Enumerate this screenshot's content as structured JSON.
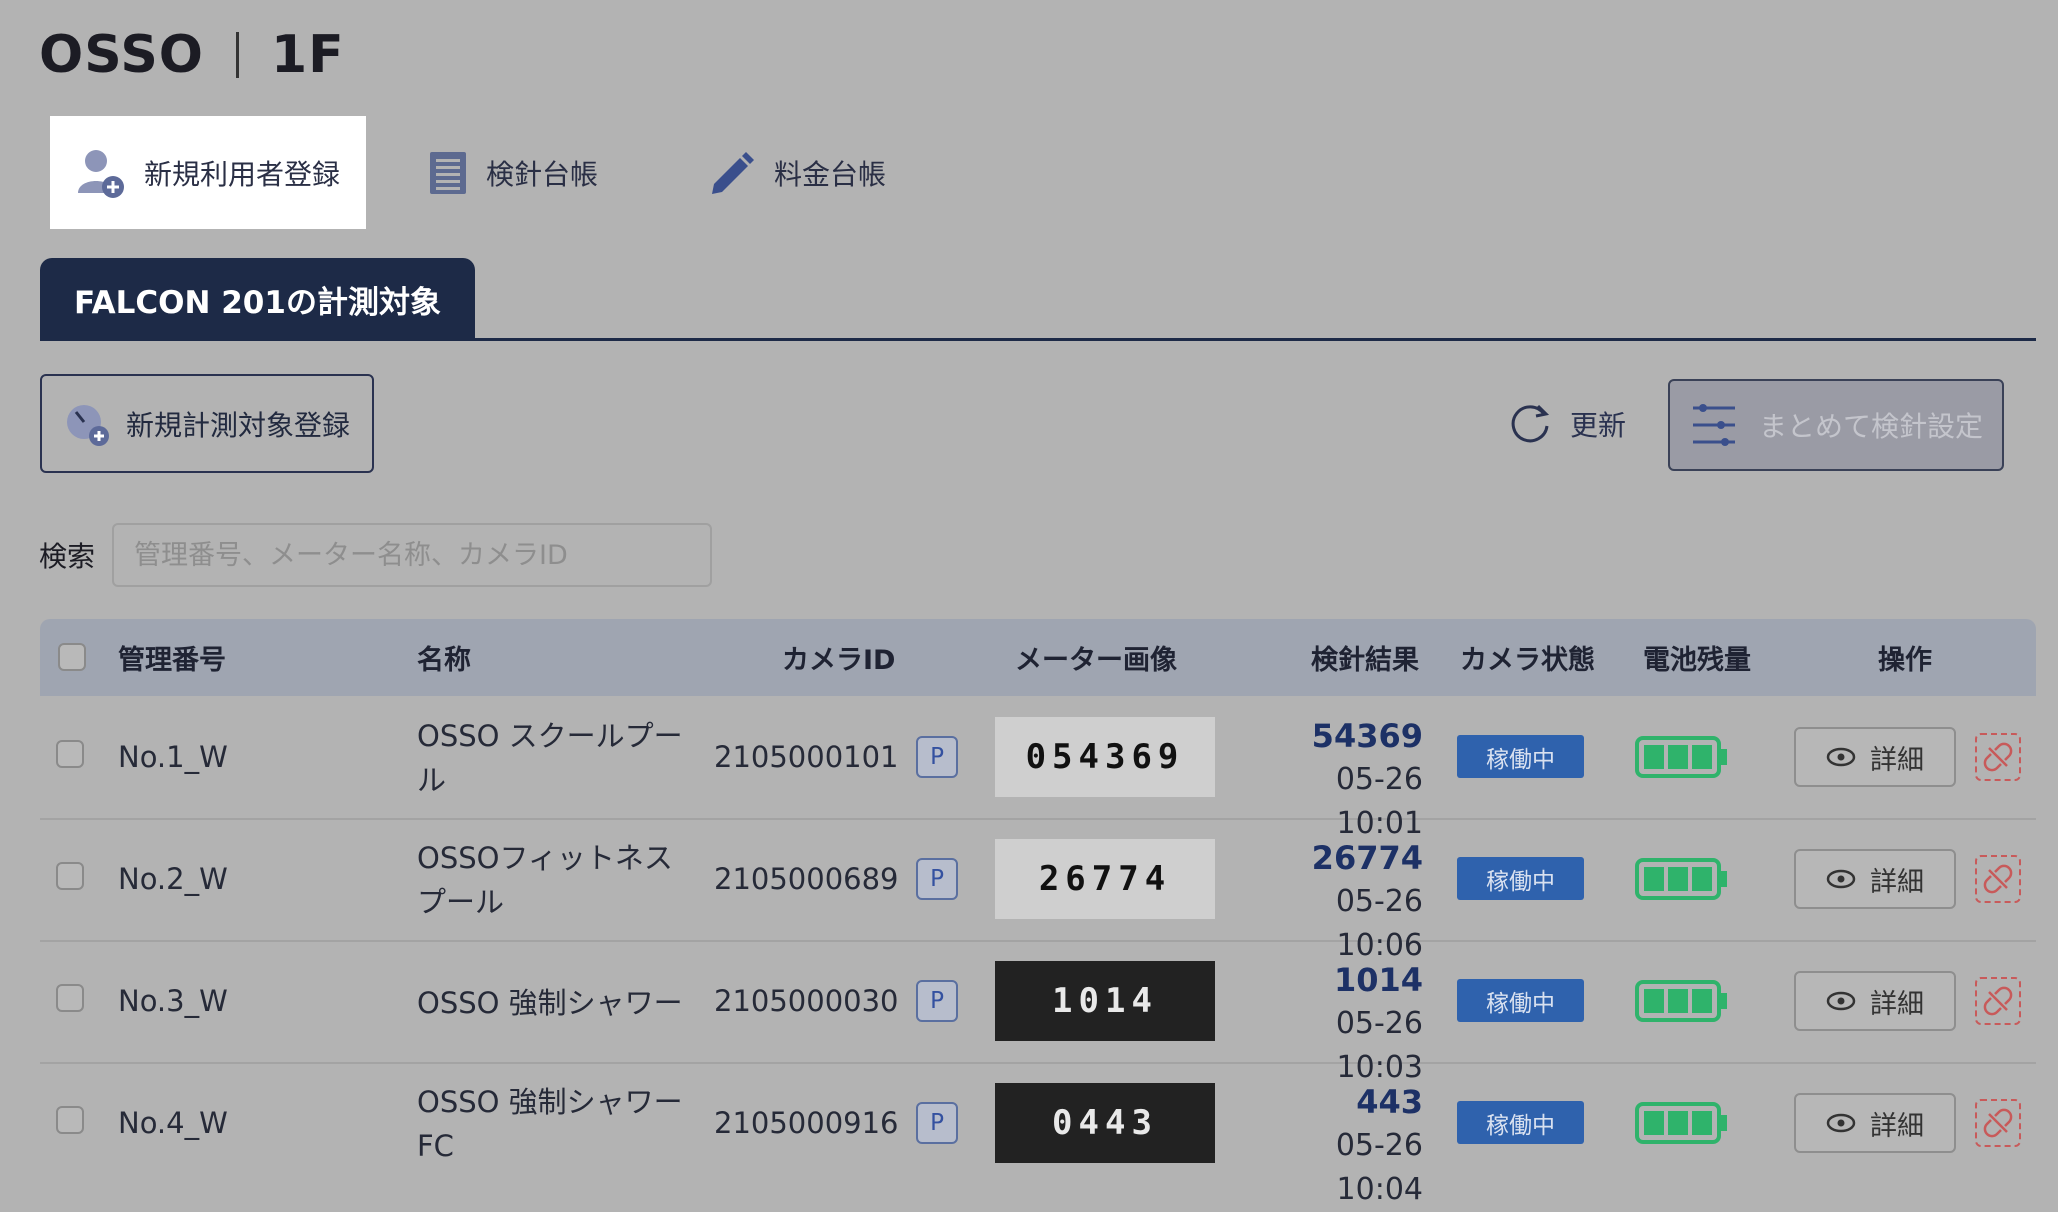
{
  "header": {
    "facility": "OSSO",
    "floor": "1F"
  },
  "nav": [
    {
      "label": "新規利用者登録",
      "icon": "user-add-icon",
      "active": true
    },
    {
      "label": "検針台帳",
      "icon": "ledger-icon",
      "active": false
    },
    {
      "label": "料金台帳",
      "icon": "pencil-icon",
      "active": false
    }
  ],
  "tab": {
    "label": "FALCON 201の計測対象"
  },
  "toolbar": {
    "register_label": "新規計測対象登録",
    "refresh_label": "更新",
    "bulk_label": "まとめて検針設定"
  },
  "search": {
    "label": "検索",
    "placeholder": "管理番号、メーター名称、カメラID",
    "value": ""
  },
  "table": {
    "columns": [
      "管理番号",
      "名称",
      "カメラID",
      "メーター画像",
      "検針結果",
      "カメラ状態",
      "電池残量",
      "操作"
    ],
    "rows": [
      {
        "id": "No.1_W",
        "name_line1": "OSSO スクールプー",
        "name_line2": "ル",
        "camera_id": "2105000101",
        "badge": "P",
        "meter_digits": "054369",
        "result": "54369",
        "time": "05-26 10:01",
        "status": "稼働中",
        "detail": "詳細"
      },
      {
        "id": "No.2_W",
        "name_line1": "OSSOフィットネス",
        "name_line2": "プール",
        "camera_id": "2105000689",
        "badge": "P",
        "meter_digits": "26774",
        "result": "26774",
        "time": "05-26 10:06",
        "status": "稼働中",
        "detail": "詳細"
      },
      {
        "id": "No.3_W",
        "name_line1": "OSSO 強制シャワー",
        "name_line2": "",
        "camera_id": "2105000030",
        "badge": "P",
        "meter_digits": "1014",
        "result": "1014",
        "time": "05-26 10:03",
        "status": "稼働中",
        "detail": "詳細"
      },
      {
        "id": "No.4_W",
        "name_line1": "OSSO 強制シャワー",
        "name_line2": "FC",
        "camera_id": "2105000916",
        "badge": "P",
        "meter_digits": "0443",
        "result": "443",
        "time": "05-26 10:04",
        "status": "稼働中",
        "detail": "詳細"
      }
    ]
  },
  "colors": {
    "navy": "#1d2a47",
    "status_blue": "#2f62ad",
    "battery_green": "#2fb36b",
    "unlink_red": "#c85a5a"
  }
}
